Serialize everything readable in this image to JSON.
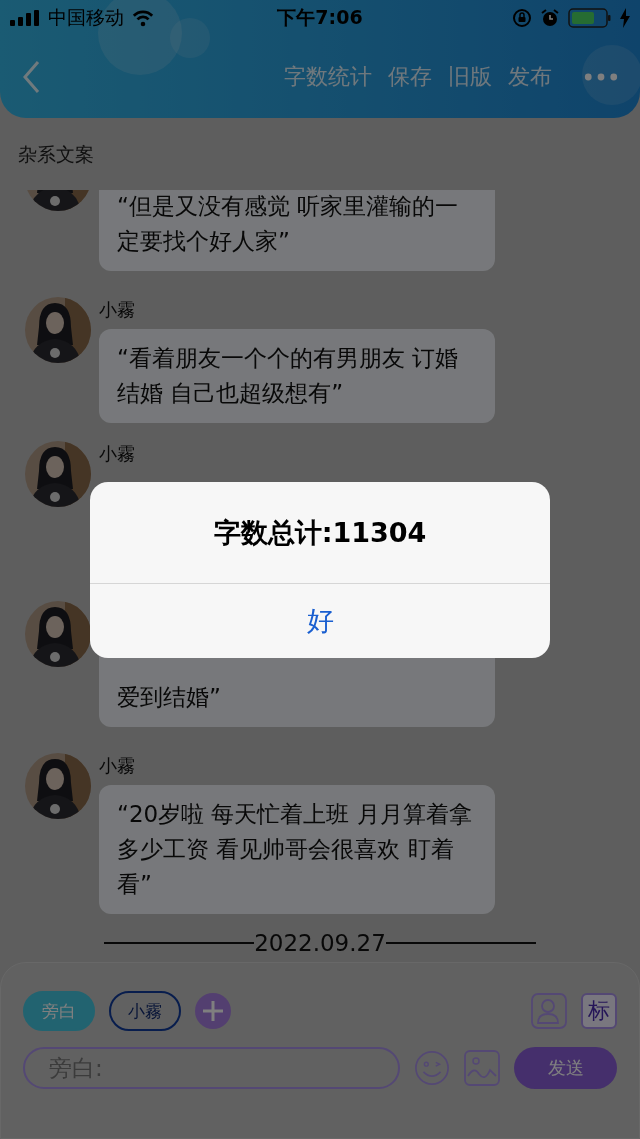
{
  "status_bar": {
    "carrier": "中国移动",
    "time": "下午7:06"
  },
  "nav": {
    "actions": [
      "字数统计",
      "保存",
      "旧版",
      "发布"
    ]
  },
  "section_title": "杂系文案",
  "messages": [
    {
      "text": "“但是又没有感觉 听家里灌输的一定要找个好人家”"
    },
    {
      "name": "小霧",
      "text": "“看着朋友一个个的有男朋友 订婚结婚 自己也超级想有”"
    },
    {
      "name": "小霧"
    },
    {
      "text": "爱到结婚”"
    },
    {
      "name": "小霧",
      "text": "“20岁啦 每天忙着上班 月月算着拿多少工资 看见帅哥会很喜欢 盯着看”"
    }
  ],
  "date_divider": "2022.09.27",
  "composer": {
    "roles": [
      {
        "label": "旁白",
        "selected": true
      },
      {
        "label": "小霧",
        "selected": false
      }
    ],
    "tag_button": "标",
    "placeholder": "旁白:",
    "send": "发送"
  },
  "dialog": {
    "message": "字数总计:11304",
    "button": "好"
  }
}
